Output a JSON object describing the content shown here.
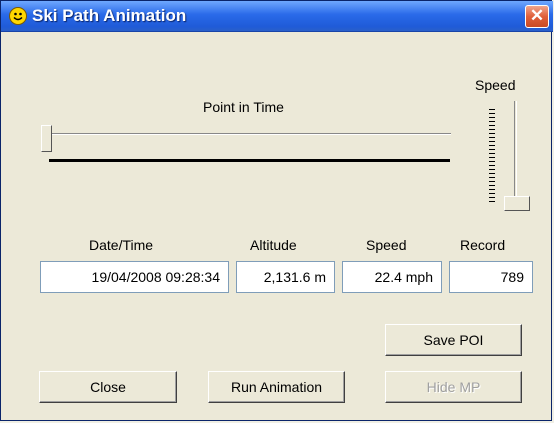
{
  "window": {
    "title": "Ski Path Animation",
    "close_glyph": "✕",
    "app_icon": "smiley-icon"
  },
  "slider": {
    "label": "Point in Time",
    "position_fraction": 0.0
  },
  "speed": {
    "label": "Speed",
    "level_fraction": 0.0
  },
  "headers": {
    "datetime": "Date/Time",
    "altitude": "Altitude",
    "speed": "Speed",
    "record": "Record"
  },
  "values": {
    "datetime": "19/04/2008 09:28:34",
    "altitude": "2,131.6 m",
    "speed": "22.4 mph",
    "record": "789"
  },
  "buttons": {
    "save_poi": "Save POI",
    "close": "Close",
    "run_animation": "Run Animation",
    "hide_mp": "Hide MP"
  }
}
